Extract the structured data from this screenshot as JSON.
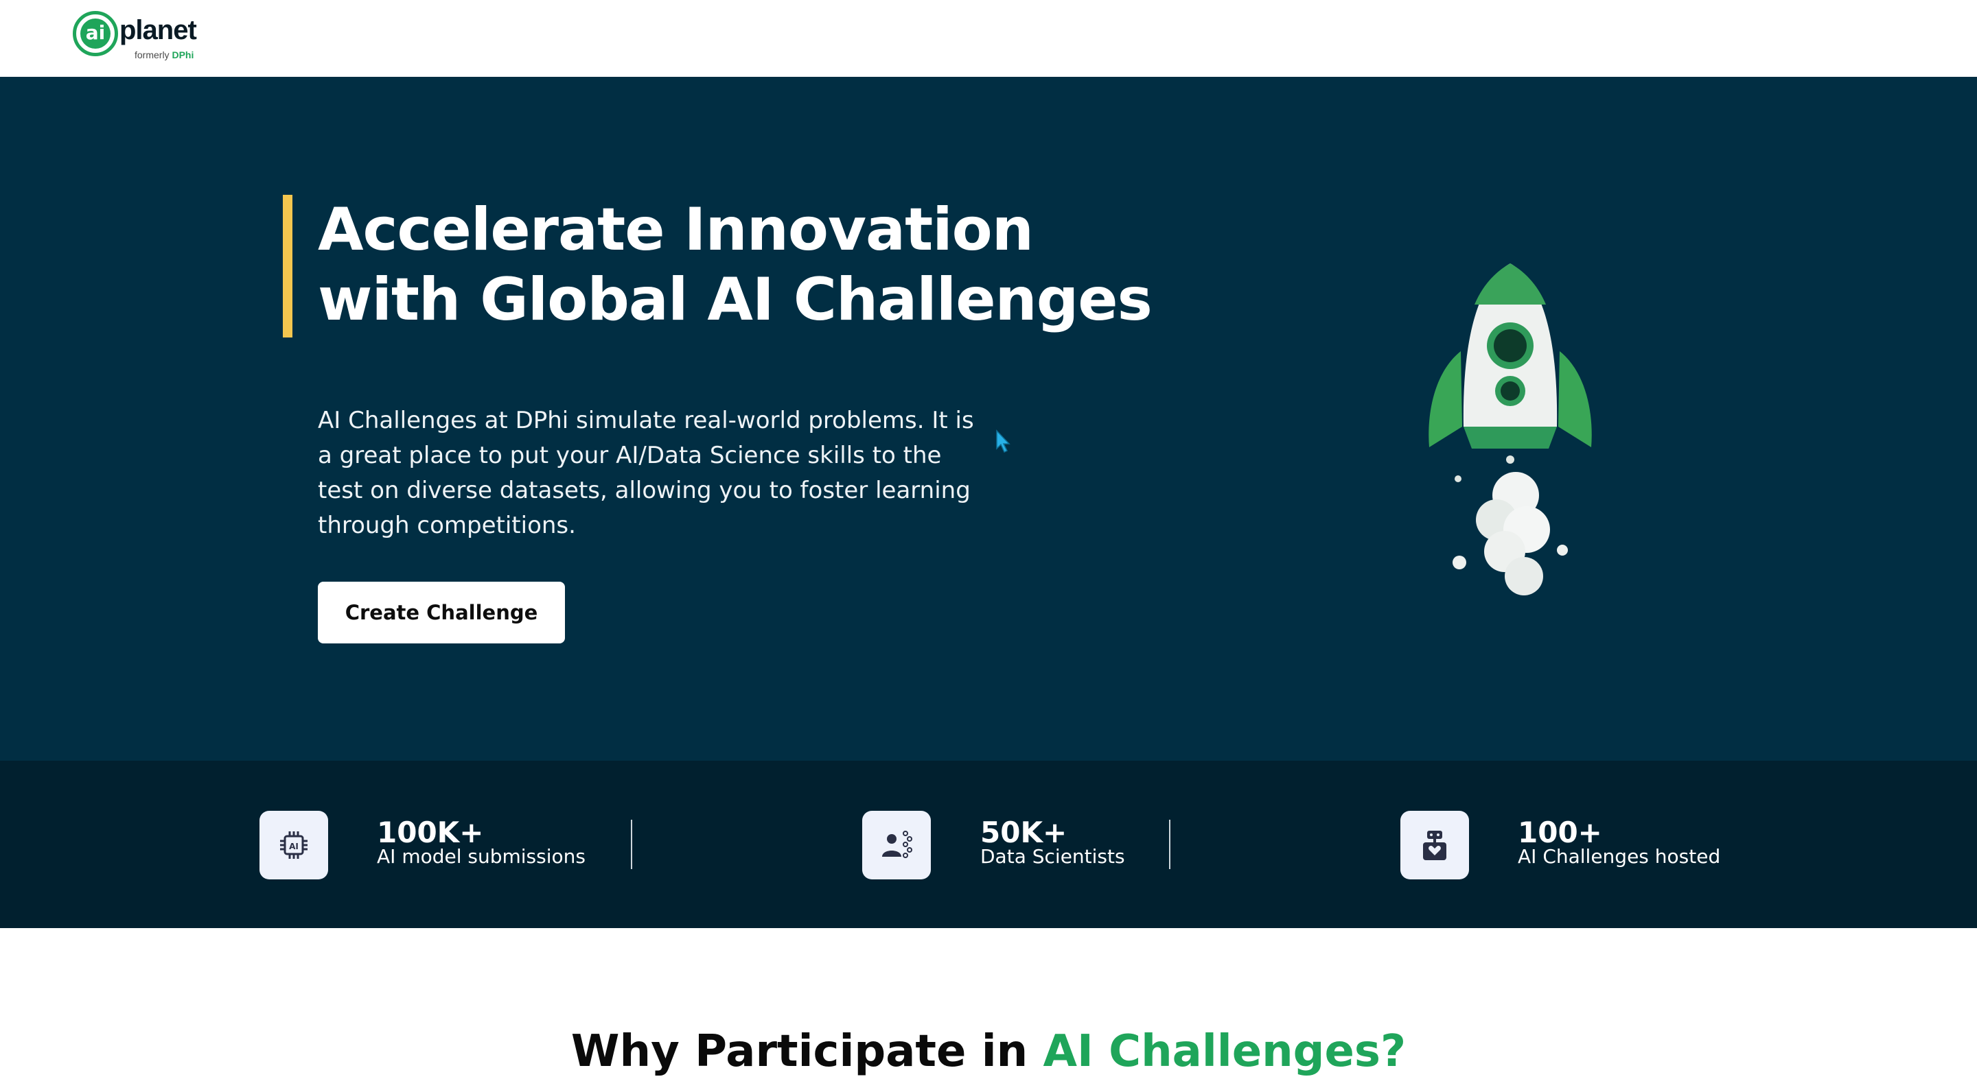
{
  "header": {
    "logo_mark": "ai",
    "logo_word": "planet",
    "logo_sub_prefix": "formerly",
    "logo_sub_brand": "DPhi"
  },
  "hero": {
    "title_line1": "Accelerate Innovation",
    "title_line2": "with Global AI Challenges",
    "description": "AI Challenges at DPhi simulate real-world problems. It is a great place to put your AI/Data Science skills to the test on diverse datasets, allowing you to foster learning through competitions.",
    "cta_label": "Create Challenge"
  },
  "stats": [
    {
      "icon": "ai-chip-icon",
      "value": "100K+",
      "label": "AI model submissions"
    },
    {
      "icon": "data-scientist-icon",
      "value": "50K+",
      "label": "Data Scientists"
    },
    {
      "icon": "robot-heart-icon",
      "value": "100+",
      "label": "AI Challenges hosted"
    }
  ],
  "why": {
    "title_prefix": "Why Participate in ",
    "title_accent": "AI Challenges?"
  },
  "colors": {
    "hero_bg": "#012e43",
    "stats_bg": "#01202f",
    "accent_green": "#1fa55a",
    "accent_yellow": "#f4c64f"
  }
}
